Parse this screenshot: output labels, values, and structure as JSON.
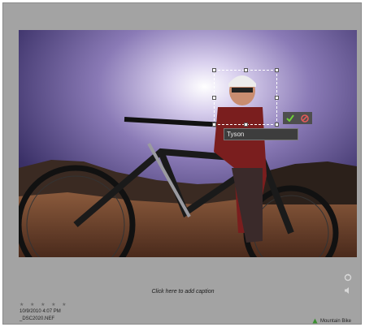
{
  "photo": {
    "face_tag": {
      "name_value": "Tyson"
    }
  },
  "caption": {
    "placeholder_text": "Click here to add caption"
  },
  "rating": {
    "stars": "★ ★ ★ ★ ★",
    "value": 0,
    "max": 5
  },
  "metadata": {
    "date_time": "10/9/2010 4:07 PM",
    "filename": "_DSC2020.NEF"
  },
  "keyword_tag": {
    "label": "Mountain Bike",
    "icon": "tag-icon",
    "color": "#3a8f2f"
  },
  "icons": {
    "confirm": "checkmark-icon",
    "reject": "cancel-icon",
    "top_right": "rotate-icon",
    "audio": "speaker-icon"
  },
  "colors": {
    "frame_background": "#a3a3a3",
    "confirm_green": "#6fcf3a",
    "reject_red": "#e05a5a"
  }
}
